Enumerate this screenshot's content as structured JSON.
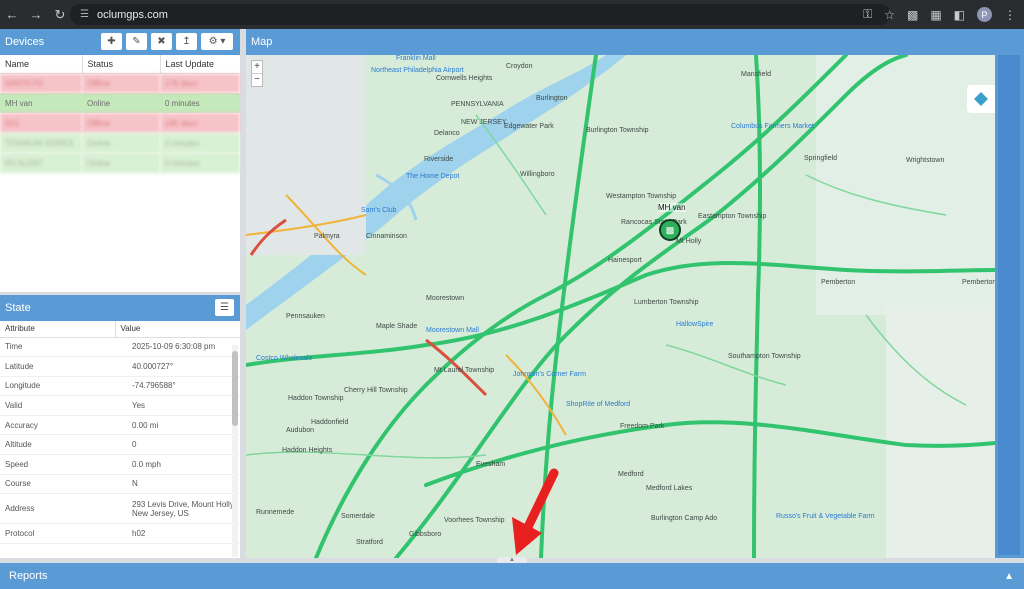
{
  "browser": {
    "url": "oclumgps.com",
    "profile_initial": "P"
  },
  "devices": {
    "title": "Devices",
    "columns": [
      "Name",
      "Status",
      "Last Update"
    ],
    "rows": [
      {
        "name": "SANTA FE",
        "status": "Offline",
        "last_update": "176 days",
        "tone": "red",
        "blurred": true
      },
      {
        "name": "MH van",
        "status": "Online",
        "last_update": "0 minutes",
        "tone": "green",
        "blurred": false
      },
      {
        "name": "S21",
        "status": "Offline",
        "last_update": "185 days",
        "tone": "red",
        "blurred": true
      },
      {
        "name": "TITANIUM SERIES",
        "status": "Online",
        "last_update": "2 minutes",
        "tone": "lgreen",
        "blurred": true
      },
      {
        "name": "RV ALERT",
        "status": "Online",
        "last_update": "0 minutes",
        "tone": "lgreen",
        "blurred": true
      }
    ]
  },
  "state": {
    "title": "State",
    "columns": [
      "Attribute",
      "Value"
    ],
    "rows": [
      {
        "attr": "Time",
        "value": "2025-10-09 6:30:08 pm"
      },
      {
        "attr": "Latitude",
        "value": "40.000727°"
      },
      {
        "attr": "Longitude",
        "value": "-74.796588°"
      },
      {
        "attr": "Valid",
        "value": "Yes"
      },
      {
        "attr": "Accuracy",
        "value": "0.00 mi"
      },
      {
        "attr": "Altitude",
        "value": "0"
      },
      {
        "attr": "Speed",
        "value": "0.0 mph"
      },
      {
        "attr": "Course",
        "value": "N"
      },
      {
        "attr": "Address",
        "value": "293 Levis Drive, Mount Holly, New Jersey, US"
      },
      {
        "attr": "Protocol",
        "value": "h02"
      }
    ]
  },
  "map": {
    "title": "Map",
    "zoom_in": "+",
    "zoom_out": "−",
    "vehicle_label": "MH van",
    "labels": [
      {
        "t": "Franklin Mall",
        "poi": true
      },
      {
        "t": "Croydon"
      },
      {
        "t": "Mansfield"
      },
      {
        "t": "Northeast Philadelphia Airport",
        "poi": true
      },
      {
        "t": "Cornwells Heights"
      },
      {
        "t": "Burlington"
      },
      {
        "t": "PENNSYLVANIA"
      },
      {
        "t": "NEW JERSEY"
      },
      {
        "t": "Edgewater Park"
      },
      {
        "t": "Burlington Township"
      },
      {
        "t": "Columbus Farmers Market",
        "poi": true
      },
      {
        "t": "Delanco"
      },
      {
        "t": "Riverside"
      },
      {
        "t": "Willingboro"
      },
      {
        "t": "The Home Depot",
        "poi": true
      },
      {
        "t": "Springfield"
      },
      {
        "t": "Wrightstown"
      },
      {
        "t": "Westampton Township"
      },
      {
        "t": "Eastampton Township"
      },
      {
        "t": "Mt Holly"
      },
      {
        "t": "Rancocas State Park"
      },
      {
        "t": "Palmyra"
      },
      {
        "t": "Cinnaminson"
      },
      {
        "t": "Sam's Club",
        "poi": true
      },
      {
        "t": "Hainesport"
      },
      {
        "t": "Pemberton"
      },
      {
        "t": "Moorestown"
      },
      {
        "t": "Lumberton Township"
      },
      {
        "t": "Pemberton Township"
      },
      {
        "t": "Pennsauken"
      },
      {
        "t": "Maple Shade"
      },
      {
        "t": "Moorestown Mall",
        "poi": true
      },
      {
        "t": "HallowSpire",
        "poi": true
      },
      {
        "t": "Costco Wholesale",
        "poi": true
      },
      {
        "t": "Mt Laurel Township"
      },
      {
        "t": "Southampton Township"
      },
      {
        "t": "Cherry Hill Township"
      },
      {
        "t": "Johnson's Corner Farm",
        "poi": true
      },
      {
        "t": "Haddon Township"
      },
      {
        "t": "Haddonfield"
      },
      {
        "t": "ShopRite of Medford",
        "poi": true
      },
      {
        "t": "Freedom Park"
      },
      {
        "t": "Audubon"
      },
      {
        "t": "Haddon Heights"
      },
      {
        "t": "Evesham"
      },
      {
        "t": "Medford"
      },
      {
        "t": "Medford Lakes"
      },
      {
        "t": "Burlington Camp Ado"
      },
      {
        "t": "Runnemede"
      },
      {
        "t": "Somerdale"
      },
      {
        "t": "Voorhees Township"
      },
      {
        "t": "Gibbsboro"
      },
      {
        "t": "Stratford"
      },
      {
        "t": "Russo's Fruit & Vegetable Farm",
        "poi": true
      }
    ]
  },
  "reports": {
    "title": "Reports"
  },
  "colors": {
    "header_blue": "#5b9bd5",
    "offline_row": "#f6c3c8",
    "online_row": "#c4e9ba",
    "map_road": "#31c36e",
    "map_base": "#d6ecd9",
    "water": "#9fd2ec"
  }
}
